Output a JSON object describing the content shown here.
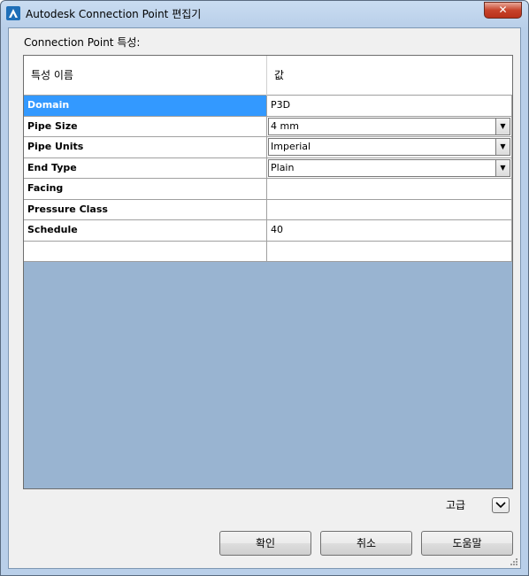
{
  "window": {
    "title": "Autodesk Connection Point 편집기",
    "close_label": "✕"
  },
  "section_label": "Connection Point 특성:",
  "grid": {
    "columns": [
      "특성 이름",
      "값"
    ],
    "rows": [
      {
        "name": "Domain",
        "value": "P3D",
        "control": "text",
        "selected": true
      },
      {
        "name": "Pipe Size",
        "value": "4 mm",
        "control": "combo"
      },
      {
        "name": "Pipe Units",
        "value": "Imperial",
        "control": "combo"
      },
      {
        "name": "End Type",
        "value": "Plain",
        "control": "combo"
      },
      {
        "name": "Facing",
        "value": "",
        "control": "text"
      },
      {
        "name": "Pressure Class",
        "value": "",
        "control": "text"
      },
      {
        "name": "Schedule",
        "value": "40",
        "control": "text"
      },
      {
        "name": "",
        "value": "",
        "control": "text"
      }
    ]
  },
  "advanced": {
    "label": "고급",
    "toggle_icon": "chevron-down"
  },
  "buttons": {
    "ok": "확인",
    "cancel": "취소",
    "help": "도움말"
  },
  "colors": {
    "selection": "#3399ff",
    "grid_background": "#99b4d1",
    "close_button": "#c7432b"
  }
}
